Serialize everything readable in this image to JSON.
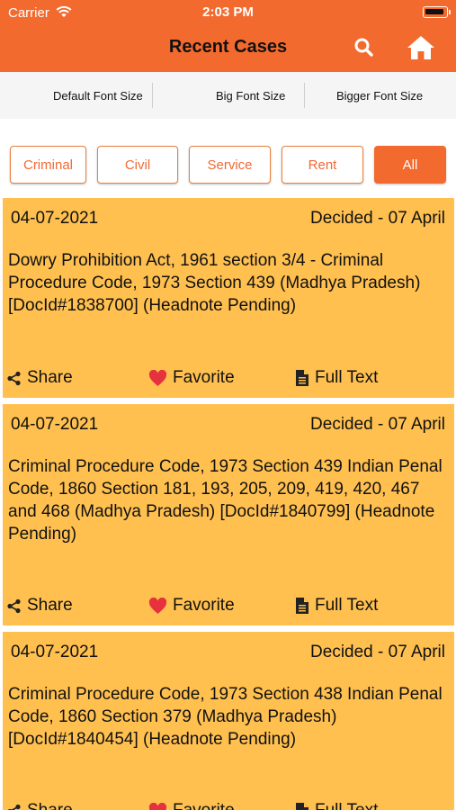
{
  "status_bar": {
    "carrier": "Carrier",
    "time": "2:03 PM"
  },
  "header": {
    "title": "Recent Cases",
    "search_icon": "search-icon",
    "home_icon": "home-icon"
  },
  "font_sizes": [
    {
      "label": "Default Font Size"
    },
    {
      "label": "Big Font Size"
    },
    {
      "label": "Bigger Font Size"
    }
  ],
  "filters": [
    {
      "label": "Criminal",
      "selected": false
    },
    {
      "label": "Civil",
      "selected": false
    },
    {
      "label": "Service",
      "selected": false
    },
    {
      "label": "Rent",
      "selected": false
    },
    {
      "label": "All",
      "selected": true
    }
  ],
  "cases": [
    {
      "date": "04-07-2021",
      "status": "Decided - 07 April",
      "description": "Dowry Prohibition Act, 1961 section 3/4 - Criminal Procedure Code, 1973 Section 439 (Madhya Pradesh) [DocId#1838700] (Headnote Pending)",
      "share_label": "Share",
      "favorite_label": "Favorite",
      "fulltext_label": "Full Text"
    },
    {
      "date": "04-07-2021",
      "status": "Decided - 07 April",
      "description": "Criminal Procedure Code, 1973 Section 439 Indian Penal Code, 1860 Section 181, 193, 205, 209, 419, 420, 467 and 468 (Madhya Pradesh) [DocId#1840799] (Headnote Pending)",
      "share_label": "Share",
      "favorite_label": "Favorite",
      "fulltext_label": "Full Text"
    },
    {
      "date": "04-07-2021",
      "status": "Decided - 07 April",
      "description": "Criminal Procedure Code, 1973 Section 438 Indian Penal Code, 1860 Section 379 (Madhya Pradesh) [DocId#1840454] (Headnote Pending)",
      "share_label": "Share",
      "favorite_label": "Favorite",
      "fulltext_label": "Full Text"
    }
  ],
  "colors": {
    "header": "#F26A2E",
    "card": "#FFC050",
    "filter_text": "#F06A35",
    "heart": "#E5323C"
  }
}
